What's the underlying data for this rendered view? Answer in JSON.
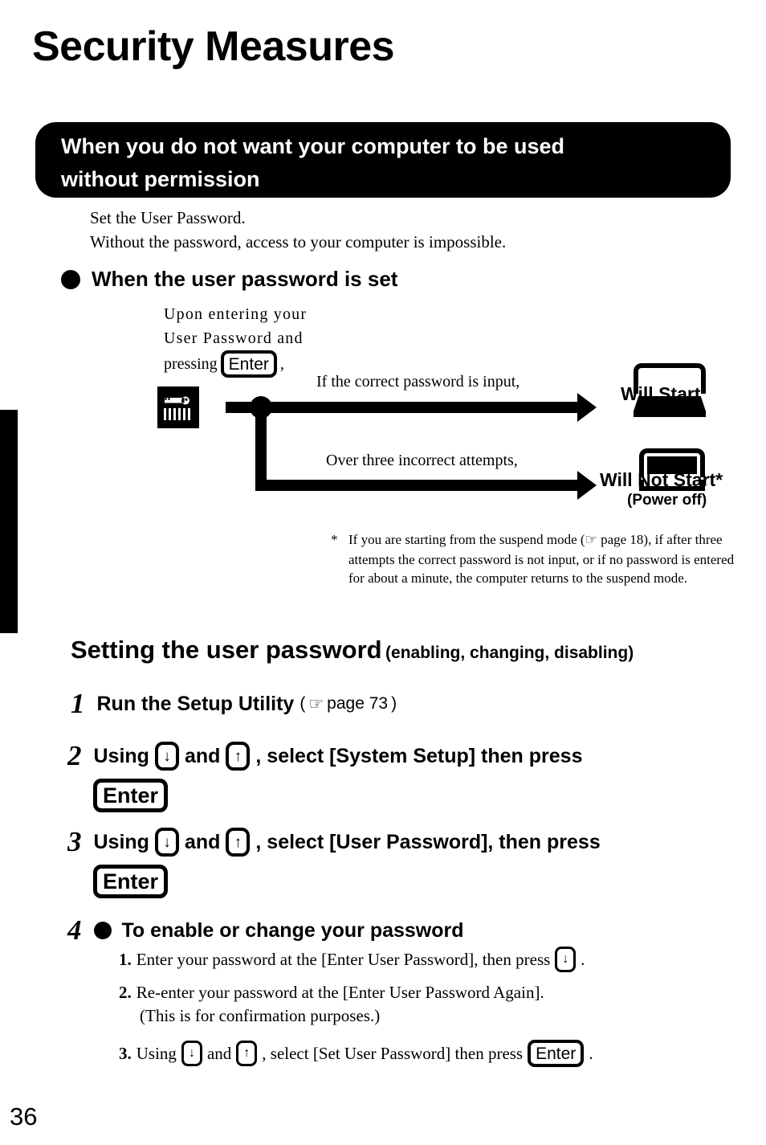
{
  "page": {
    "title": "Security Measures",
    "page_number": "36"
  },
  "banner": {
    "text": "When you do not want your computer to be used\nwithout permission"
  },
  "intro": {
    "text": "Set the User Password.\nWithout the password, access to your computer is impossible."
  },
  "bullet_heading": {
    "label": "When the user password is set"
  },
  "flow": {
    "intro_line1": "Upon  entering  your",
    "intro_line2": "User  Password  and",
    "intro_line3_pre": "pressing",
    "intro_line3_key": "Enter",
    "intro_line3_post": ",",
    "key_icon_name": "key-and-keyboard-icon",
    "branch_top_label": "If the correct password is input,",
    "branch_bottom_label": "Over three incorrect attempts,",
    "result_start": "Will Start",
    "result_not_start": "Will Not Start*",
    "result_not_start_sub": "(Power off)"
  },
  "footnote": {
    "marker": "*",
    "part1": "If you are starting from the suspend mode (",
    "hand_icon": "☞",
    "part2": " page 18), if after three attempts the correct password is not input, or if no password is entered for about a minute, the computer returns to the suspend mode."
  },
  "section2": {
    "heading_main": "Setting the user password",
    "heading_sub": "(enabling, changing, disabling)",
    "steps": [
      {
        "num": "1",
        "text_pre": "Run the Setup Utility",
        "paren_open": "(",
        "hand_icon": "☞",
        "page_ref": "page 73",
        "paren_close": ")"
      },
      {
        "num": "2",
        "t1": "Using",
        "key_down": "↓",
        "t2": "and",
        "key_up": "↑",
        "t3": ", select [System Setup] then press",
        "key_enter": "Enter"
      },
      {
        "num": "3",
        "t1": "Using",
        "key_down": "↓",
        "t2": "and",
        "key_up": "↑",
        "t3": ", select [User Password], then press",
        "key_enter": "Enter"
      },
      {
        "num": "4",
        "heading": "To enable or change your password"
      }
    ],
    "substeps": [
      {
        "num": "1.",
        "t1": "Enter your password at the [Enter User Password], then press",
        "key": "↓",
        "t2": "."
      },
      {
        "num": "2.",
        "t1": "Re-enter your password at the [Enter User Password Again].",
        "t2": "(This is for confirmation purposes.)"
      },
      {
        "num": "3.",
        "t1": "Using",
        "key_down": "↓",
        "t2": "and",
        "key_up": "↑",
        "t3": ", select [Set User Password] then press",
        "key_enter": "Enter",
        "t4": "."
      }
    ]
  }
}
